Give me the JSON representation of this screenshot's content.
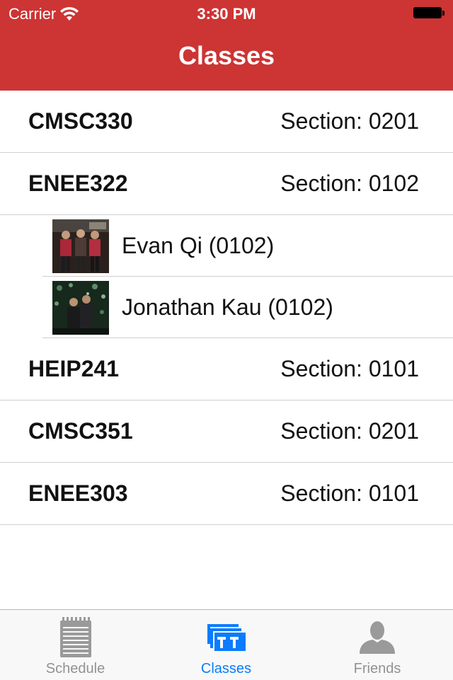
{
  "status_bar": {
    "carrier": "Carrier",
    "time": "3:30 PM"
  },
  "nav": {
    "title": "Classes",
    "bar_color": "#cd3434"
  },
  "classes": [
    {
      "code": "CMSC330",
      "section": "Section: 0201"
    },
    {
      "code": "ENEE322",
      "section": "Section: 0102"
    },
    {
      "code": "HEIP241",
      "section": "Section: 0101"
    },
    {
      "code": "CMSC351",
      "section": "Section: 0201"
    },
    {
      "code": "ENEE303",
      "section": "Section: 0101"
    }
  ],
  "friends": [
    {
      "name": "Evan Qi (0102)"
    },
    {
      "name": "Jonathan Kau (0102)"
    }
  ],
  "tabs": [
    {
      "label": "Schedule",
      "icon": "notepad-icon",
      "active": false
    },
    {
      "label": "Classes",
      "icon": "classes-icon",
      "active": true
    },
    {
      "label": "Friends",
      "icon": "person-icon",
      "active": false
    }
  ],
  "colors": {
    "accent": "#0a7cff",
    "inactive_tab": "#929292"
  }
}
